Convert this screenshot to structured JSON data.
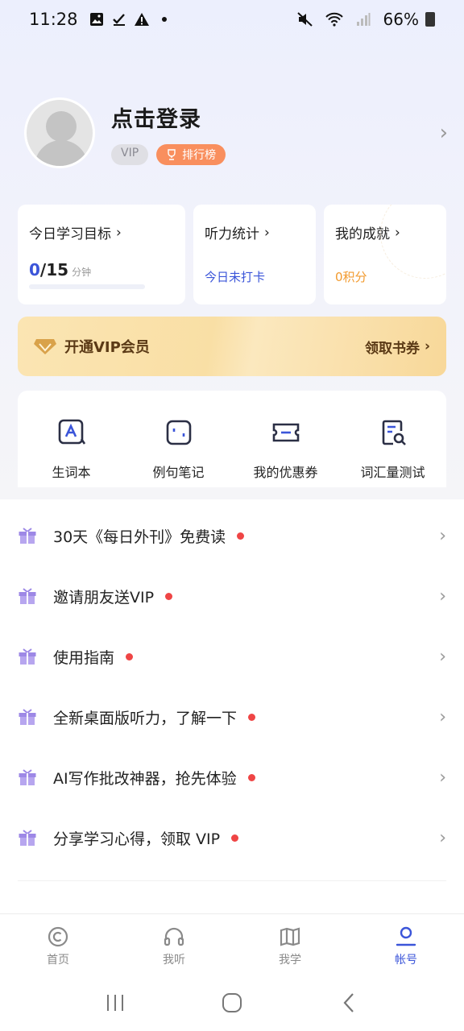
{
  "status": {
    "time": "11:28",
    "battery": "66%"
  },
  "profile": {
    "title": "点击登录",
    "vip_badge": "VIP",
    "rank_badge": "排行榜"
  },
  "cards": {
    "goal": {
      "title": "今日学习目标",
      "current": "0",
      "total": "/15",
      "unit": "分钟"
    },
    "listening": {
      "title": "听力统计",
      "value": "今日未打卡"
    },
    "achievement": {
      "title": "我的成就",
      "value": "0积分"
    }
  },
  "vip_banner": {
    "title": "开通VIP会员",
    "cta": "领取书券"
  },
  "tools": [
    {
      "label": "生词本"
    },
    {
      "label": "例句笔记"
    },
    {
      "label": "我的优惠券"
    },
    {
      "label": "词汇量测试"
    }
  ],
  "menu": [
    {
      "label": "30天《每日外刊》免费读"
    },
    {
      "label": "邀请朋友送VIP"
    },
    {
      "label": "使用指南"
    },
    {
      "label": "全新桌面版听力，了解一下"
    },
    {
      "label": "AI写作批改神器，抢先体验"
    },
    {
      "label": "分享学习心得，领取 VIP"
    }
  ],
  "tabs": [
    {
      "label": "首页"
    },
    {
      "label": "我听"
    },
    {
      "label": "我学"
    },
    {
      "label": "帐号"
    }
  ],
  "colors": {
    "accent": "#3b55d9",
    "orange": "#f98f5e",
    "red_dot": "#ef4545"
  }
}
